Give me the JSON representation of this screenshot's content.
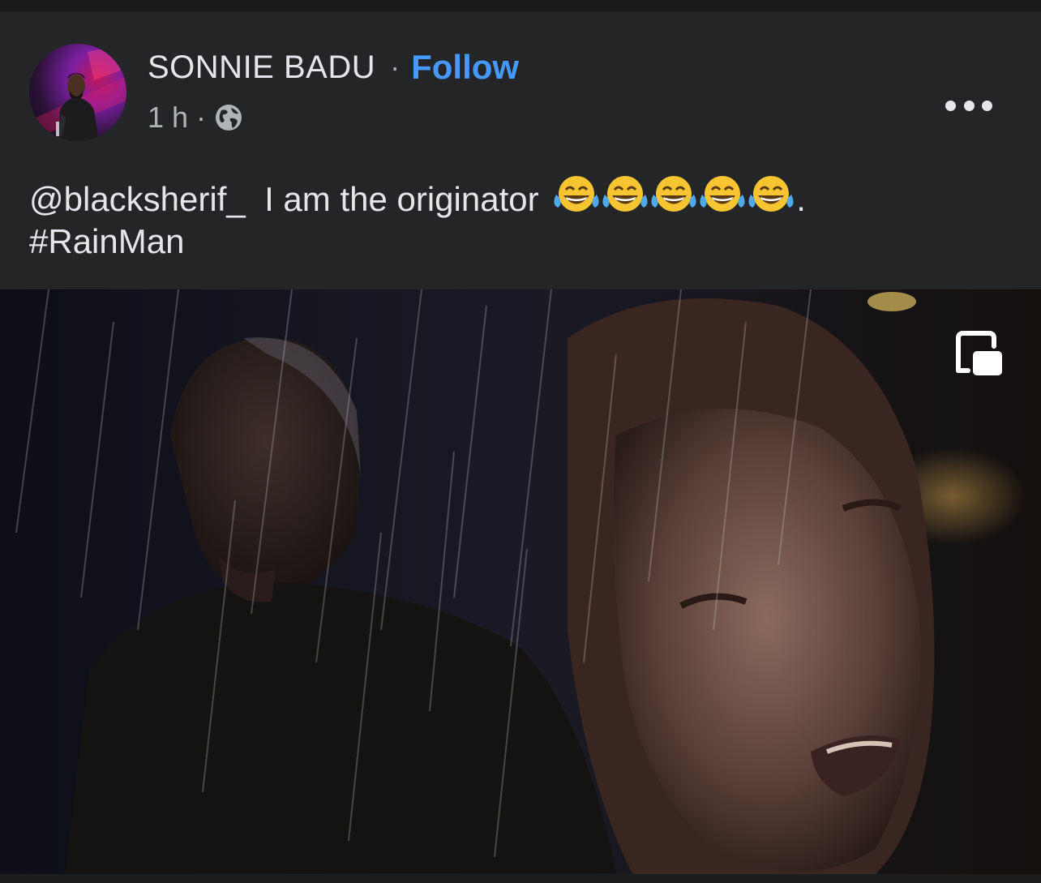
{
  "post": {
    "author": "SONNIE BADU",
    "separator": "·",
    "follow_label": "Follow",
    "time": "1 h",
    "audience_icon": "globe-icon",
    "more_icon": "more-options-icon",
    "text": {
      "mention": "@blacksherif_",
      "body": "I am the originator",
      "emoji_name": "face-with-tears-of-joy",
      "trailing": ".",
      "hashtag": "#RainMan"
    },
    "media": {
      "type": "video",
      "pip_icon": "picture-in-picture-icon"
    }
  },
  "colors": {
    "background": "#242526",
    "text": "#e4e6eb",
    "secondary_text": "#b0b3b8",
    "link": "#4599ff"
  }
}
